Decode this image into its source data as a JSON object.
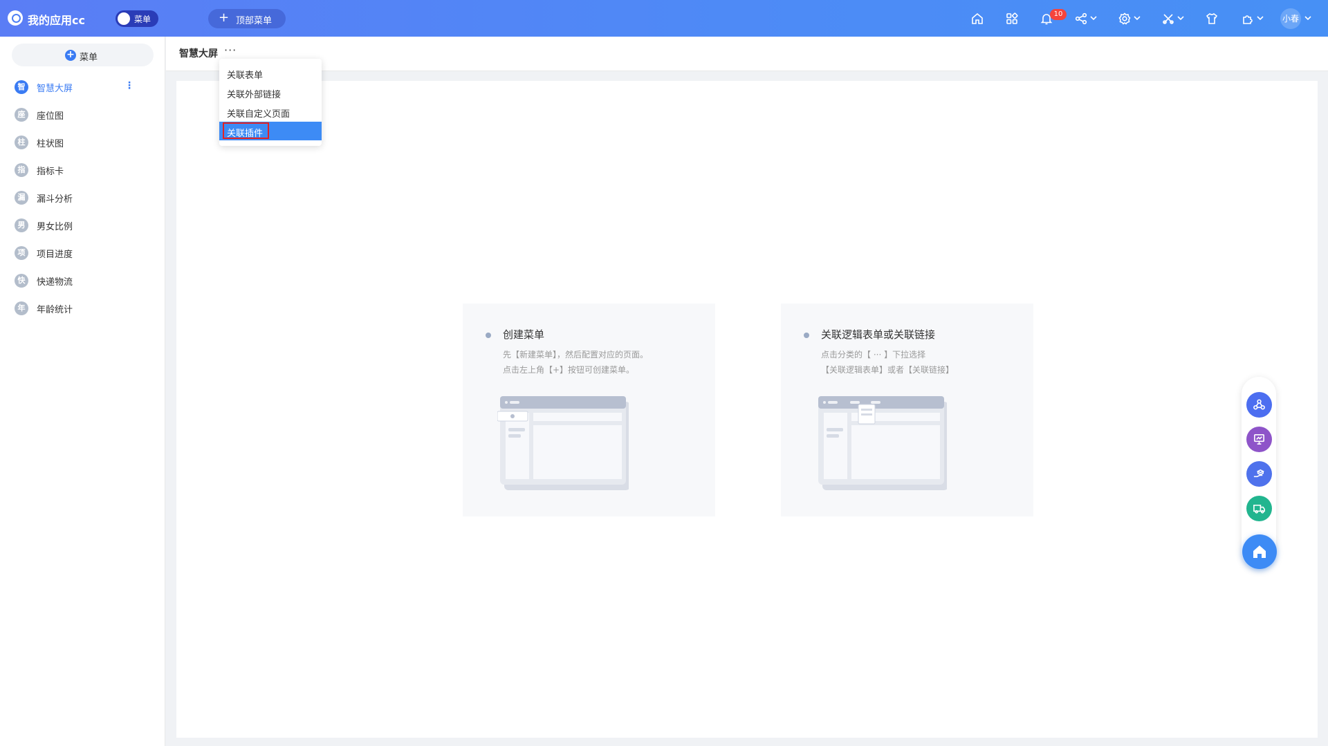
{
  "app": {
    "title": "我的应用cc"
  },
  "topbar": {
    "toggle_label": "菜单",
    "top_menu_label": "顶部菜单",
    "notification_count": "10",
    "user_name": "小春",
    "icons": [
      "home-icon",
      "apps-grid-icon",
      "bell-icon",
      "share-icon",
      "settings-icon",
      "tools-icon",
      "shirt-icon",
      "plugin-icon"
    ]
  },
  "sidebar": {
    "add_label": "菜单",
    "items": [
      {
        "initial": "智",
        "label": "智慧大屏"
      },
      {
        "initial": "座",
        "label": "座位图"
      },
      {
        "initial": "柱",
        "label": "柱状图"
      },
      {
        "initial": "指",
        "label": "指标卡"
      },
      {
        "initial": "漏",
        "label": "漏斗分析"
      },
      {
        "initial": "男",
        "label": "男女比例"
      },
      {
        "initial": "项",
        "label": "项目进度"
      },
      {
        "initial": "快",
        "label": "快递物流"
      },
      {
        "initial": "年",
        "label": "年龄统计"
      }
    ],
    "more": "⋮"
  },
  "header": {
    "page_title": "智慧大屏",
    "more": "···"
  },
  "dropdown": {
    "items": [
      "关联表单",
      "关联外部链接",
      "关联自定义页面",
      "关联插件"
    ]
  },
  "cards": [
    {
      "title": "创建菜单",
      "line1": "先【新建菜单】，然后配置对应的页面。",
      "line2": "点击左上角【+】按钮可创建菜单。"
    },
    {
      "title": "关联逻辑表单或关联链接",
      "line1": "点击分类的【 ··· 】下拉选择",
      "line2": "【关联逻辑表单】或者【关联链接】"
    }
  ],
  "colors": {
    "topbar": "#4d8bf6",
    "accent": "#3a7bf3",
    "selected": "#3d8bf5",
    "float_buttons": [
      "#4c6ef0",
      "#8e54c9",
      "#4f72ec",
      "#22b58f"
    ]
  }
}
